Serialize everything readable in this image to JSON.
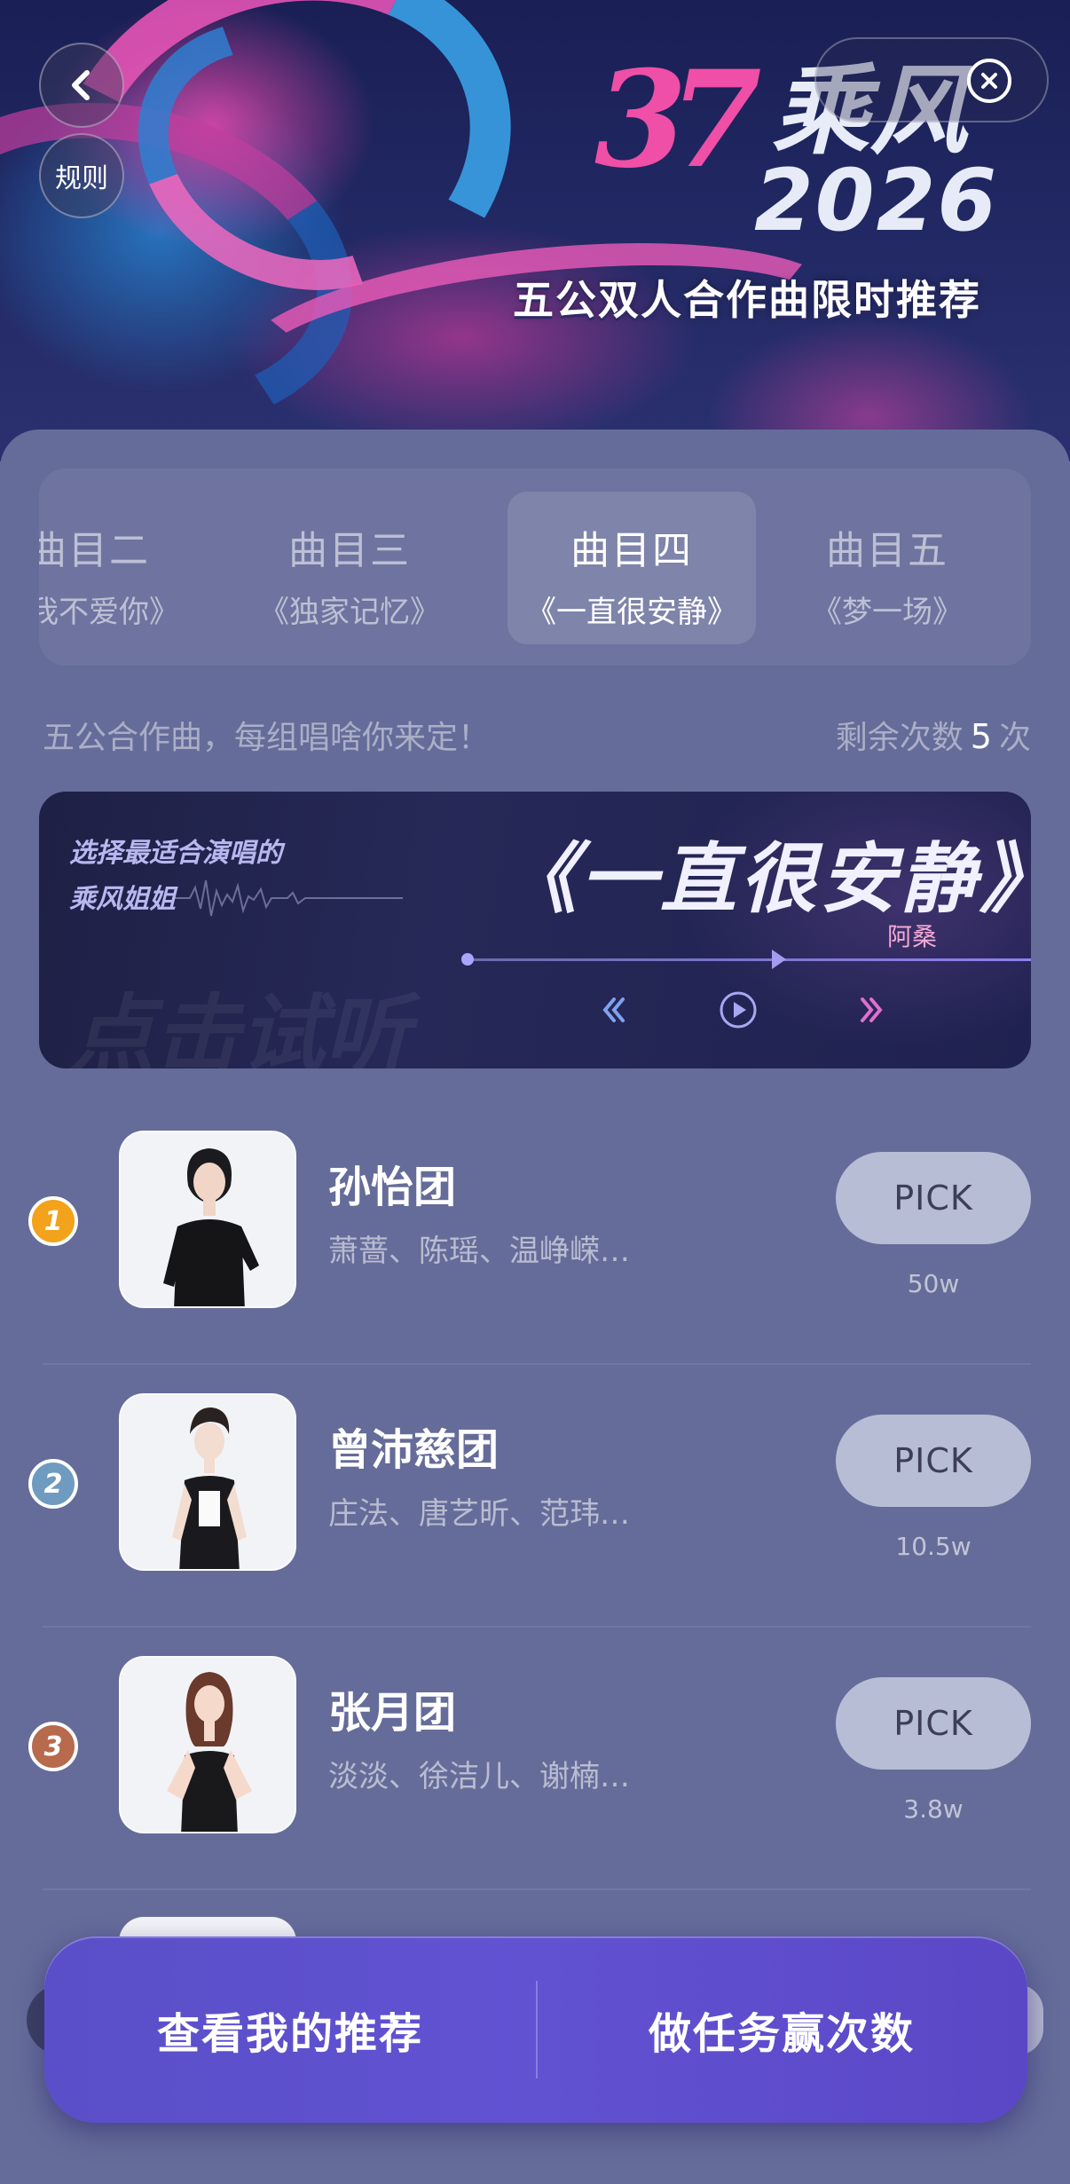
{
  "header": {
    "rules_label": "规则",
    "logo_mark": "37",
    "logo_title": "乘风",
    "logo_year": "2026",
    "subtitle": "五公双人合作曲限时推荐"
  },
  "tabs": [
    {
      "title": "曲目二",
      "song": "说我不爱你》"
    },
    {
      "title": "曲目三",
      "song": "《独家记忆》"
    },
    {
      "title": "曲目四",
      "song": "《一直很安静》",
      "active": true
    },
    {
      "title": "曲目五",
      "song": "《梦一场》"
    }
  ],
  "info": {
    "hint": "五公合作曲，每组唱啥你来定！",
    "remaining_label": "剩余次数",
    "remaining_count": "5",
    "remaining_unit": "次"
  },
  "audio_card": {
    "tag_line1": "选择最适合演唱的",
    "tag_line2": "乘风姐姐",
    "song_title": "《一直很安静》",
    "artist": "阿桑",
    "listen_hint": "点击试听"
  },
  "groups": [
    {
      "rank": "1",
      "name": "孙怡团",
      "members": "萧蔷、陈瑶、温峥嵘…",
      "button": "PICK",
      "votes": "50w",
      "rank_color": "#f2a21b"
    },
    {
      "rank": "2",
      "name": "曾沛慈团",
      "members": "庄法、唐艺昕、范玮…",
      "button": "PICK",
      "votes": "10.5w",
      "rank_color": "#6f9bc0"
    },
    {
      "rank": "3",
      "name": "张月团",
      "members": "淡淡、徐洁儿、谢楠…",
      "button": "PICK",
      "votes": "3.8w",
      "rank_color": "#b76a4c"
    }
  ],
  "bottom_bar": {
    "left_label": "查看我的推荐",
    "right_label": "做任务赢次数"
  },
  "colors": {
    "page_bg": "#656c99",
    "accent_pink": "#ef4fa6",
    "bottom_bar": "#5a4fc8",
    "pick_button": "#b8bdd6"
  }
}
